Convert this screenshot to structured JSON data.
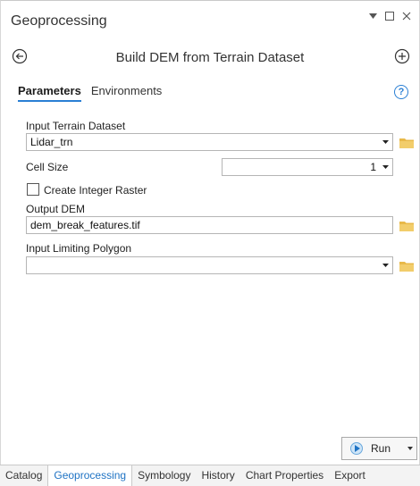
{
  "pane": {
    "title": "Geoprocessing"
  },
  "header": {
    "tool_title": "Build DEM from Terrain Dataset"
  },
  "tabs": [
    {
      "label": "Parameters",
      "active": true
    },
    {
      "label": "Environments",
      "active": false
    }
  ],
  "help": {
    "glyph": "?"
  },
  "params": {
    "input_terrain": {
      "label": "Input Terrain Dataset",
      "value": "Lidar_trn"
    },
    "cell_size": {
      "label": "Cell Size",
      "value": "1"
    },
    "create_integer": {
      "label": "Create Integer Raster",
      "checked": false
    },
    "output_dem": {
      "label": "Output DEM",
      "value": "dem_break_features.tif"
    },
    "limiting_polygon": {
      "label": "Input Limiting Polygon",
      "value": ""
    }
  },
  "run": {
    "label": "Run"
  },
  "bottom_tabs": [
    {
      "label": "Catalog",
      "active": false
    },
    {
      "label": "Geoprocessing",
      "active": true
    },
    {
      "label": "Symbology",
      "active": false
    },
    {
      "label": "History",
      "active": false
    },
    {
      "label": "Chart Properties",
      "active": false
    },
    {
      "label": "Export",
      "active": false
    }
  ],
  "colors": {
    "accent": "#2a7fd4",
    "folder": "#e8b94a",
    "active_tab_text": "#1f73c4"
  }
}
